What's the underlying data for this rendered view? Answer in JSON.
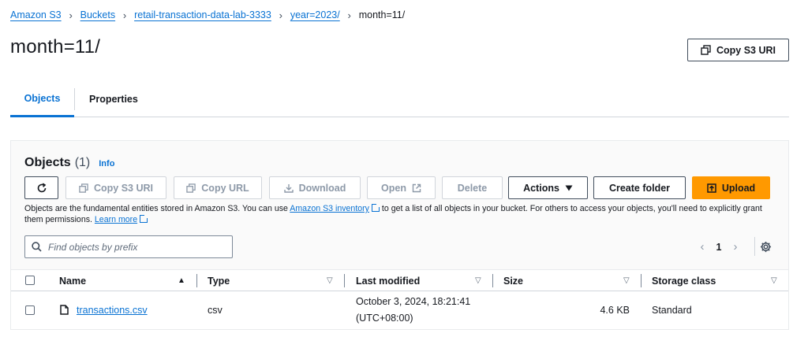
{
  "breadcrumb": {
    "items": [
      "Amazon S3",
      "Buckets",
      "retail-transaction-data-lab-3333",
      "year=2023/"
    ],
    "current": "month=11/"
  },
  "page": {
    "title": "month=11/",
    "copy_uri_label": "Copy S3 URI"
  },
  "tabs": [
    {
      "label": "Objects",
      "active": true
    },
    {
      "label": "Properties",
      "active": false
    }
  ],
  "objects_panel": {
    "title": "Objects",
    "count": "(1)",
    "info_label": "Info",
    "toolbar": {
      "refresh_icon": "refresh-icon",
      "copy_s3_uri": "Copy S3 URI",
      "copy_url": "Copy URL",
      "download": "Download",
      "open": "Open",
      "delete": "Delete",
      "actions": "Actions",
      "create_folder": "Create folder",
      "upload": "Upload"
    },
    "description": {
      "part1": "Objects are the fundamental entities stored in Amazon S3. You can use ",
      "inventory_link": "Amazon S3 inventory",
      "part2": " to get a list of all objects in your bucket. For others to access your objects, you'll need to explicitly grant them permissions. ",
      "learn_more": "Learn more"
    },
    "search": {
      "placeholder": "Find objects by prefix",
      "value": ""
    },
    "pagination": {
      "current_page": "1"
    },
    "table": {
      "columns": [
        "Name",
        "Type",
        "Last modified",
        "Size",
        "Storage class"
      ],
      "rows": [
        {
          "name": "transactions.csv",
          "type": "csv",
          "last_modified_line1": "October 3, 2024, 18:21:41",
          "last_modified_line2": "(UTC+08:00)",
          "size": "4.6 KB",
          "storage_class": "Standard"
        }
      ]
    }
  },
  "colors": {
    "link": "#0972d3",
    "primary_button": "#ff9900",
    "text": "#16191f",
    "border": "#d1d5db"
  }
}
